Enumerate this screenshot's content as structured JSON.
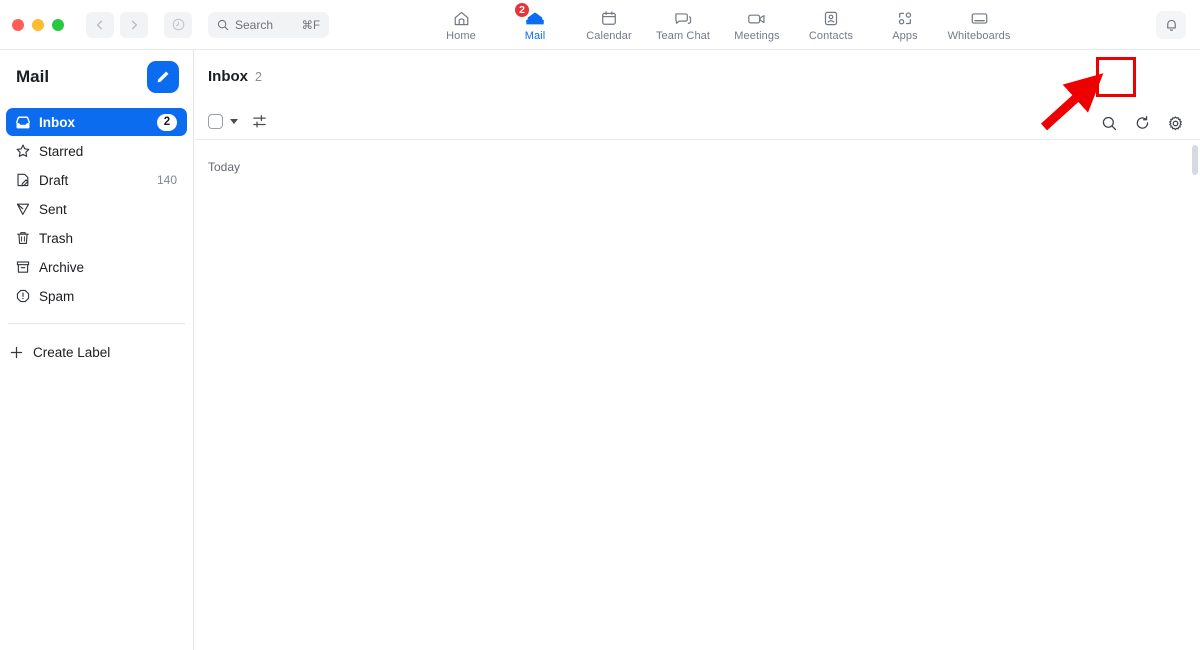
{
  "window": {
    "traffic_lights": [
      "close",
      "minimize",
      "maximize"
    ],
    "back_label": "Back",
    "forward_label": "Forward",
    "history_label": "History",
    "search": {
      "placeholder": "Search",
      "shortcut": "⌘F",
      "value": ""
    }
  },
  "nav": {
    "tabs": [
      {
        "label": "Home",
        "icon": "home-icon",
        "active": false,
        "badge": ""
      },
      {
        "label": "Mail",
        "icon": "mail-icon",
        "active": true,
        "badge": "2"
      },
      {
        "label": "Calendar",
        "icon": "calendar-icon",
        "active": false,
        "badge": ""
      },
      {
        "label": "Team Chat",
        "icon": "chat-bubbles-icon",
        "active": false,
        "badge": ""
      },
      {
        "label": "Meetings",
        "icon": "video-camera-icon",
        "active": false,
        "badge": ""
      },
      {
        "label": "Contacts",
        "icon": "contact-card-icon",
        "active": false,
        "badge": ""
      },
      {
        "label": "Apps",
        "icon": "apps-icon",
        "active": false,
        "badge": ""
      },
      {
        "label": "Whiteboards",
        "icon": "whiteboard-icon",
        "active": false,
        "badge": ""
      }
    ],
    "notifications_label": "Notifications"
  },
  "sidebar": {
    "title": "Mail",
    "compose_label": "Compose",
    "items": [
      {
        "label": "Inbox",
        "icon": "inbox-icon",
        "count": "2",
        "active": true
      },
      {
        "label": "Starred",
        "icon": "star-icon",
        "count": "",
        "active": false
      },
      {
        "label": "Draft",
        "icon": "draft-icon",
        "count": "140",
        "active": false
      },
      {
        "label": "Sent",
        "icon": "send-icon",
        "count": "",
        "active": false
      },
      {
        "label": "Trash",
        "icon": "trash-icon",
        "count": "",
        "active": false
      },
      {
        "label": "Archive",
        "icon": "archive-icon",
        "count": "",
        "active": false
      },
      {
        "label": "Spam",
        "icon": "spam-icon",
        "count": "",
        "active": false
      }
    ],
    "create_label": "Create Label"
  },
  "main": {
    "title": "Inbox",
    "count": "2",
    "select_all_label": "Select all",
    "select_dropdown_label": "Selection options",
    "filter_label": "Filter",
    "search_label": "Search mail",
    "refresh_label": "Refresh",
    "settings_label": "Mail settings",
    "group_label": "Today",
    "messages": []
  },
  "annotation": {
    "highlight_target": "search-mail-button",
    "highlight_color": "#ef0000",
    "arrow_color": "#ef0000"
  }
}
